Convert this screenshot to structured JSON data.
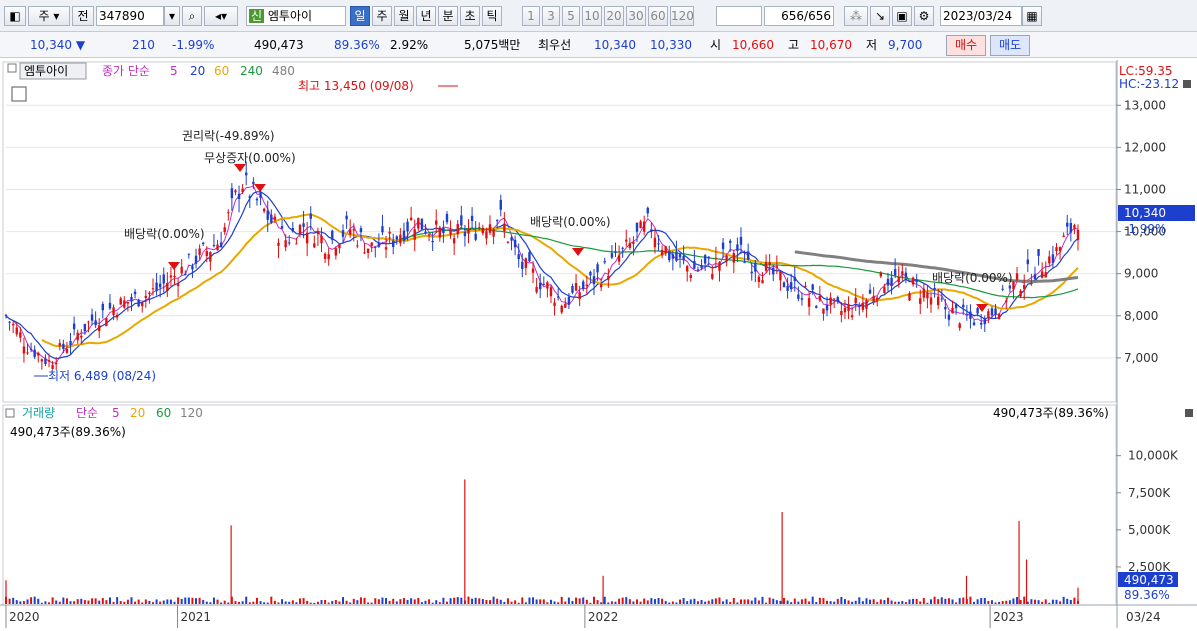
{
  "toolbar": {
    "type_label": "주",
    "jeon_label": "전",
    "code": "347890",
    "shin_label": "신",
    "name": "엠투아이",
    "periods": [
      "일",
      "주",
      "월",
      "년",
      "분",
      "초",
      "틱"
    ],
    "numbers": [
      "1",
      "3",
      "5",
      "10",
      "20",
      "30",
      "60",
      "120"
    ],
    "count": "656",
    "count_total": "/656",
    "date": "2023/03/24"
  },
  "quote": {
    "price": "10,340",
    "change": "210",
    "change_pct": "-1.99%",
    "volume": "490,473",
    "volume_pct": "89.36%",
    "turnover": "2.92%",
    "amount": "5,075백만",
    "bid_label": "최우선",
    "bid1": "10,340",
    "bid2": "10,330",
    "open_label": "시",
    "open": "10,660",
    "high_label": "고",
    "high": "10,670",
    "low_label": "저",
    "low": "9,700",
    "buy_label": "매수",
    "sell_label": "매도"
  },
  "colors": {
    "candle_up": "#e01010",
    "candle_down": "#1c3fce",
    "ma5": "#c030c0",
    "ma20": "#1c3fce",
    "ma60": "#e8a800",
    "ma240": "#1a9a3a",
    "ma480": "#808080",
    "vol_up": "#e01010",
    "vol_down": "#1c3fce"
  },
  "price_panel": {
    "legend_name": "엠투아이",
    "legend_items": [
      "종가 단순",
      "5",
      "20",
      "60",
      "240",
      "480"
    ],
    "lc": "LC:59.35",
    "hc": "HC:-23.12",
    "last_price": "10,340",
    "last_pct": "-1.99%",
    "annotations": {
      "high": "최고 13,450 (09/08)",
      "low": "최저 6,489 (08/24)",
      "rights": "권리락(-49.89%)",
      "bonus": "무상증자(0.00%)",
      "div1": "배당락(0.00%)",
      "div2": "배당락(0.00%)",
      "div3": "배당락(0.00%)"
    }
  },
  "volume_panel": {
    "legend_name": "거래량",
    "legend_items": [
      "단순",
      "5",
      "20",
      "60",
      "120"
    ],
    "label_left": "490,473주(89.36%)",
    "label_right": "490,473주(89.36%)",
    "last_volume": "490,473",
    "last_pct": "89.36%"
  },
  "chart_data": {
    "type": "candlestick",
    "y_axis": [
      "13,000",
      "12,000",
      "11,000",
      "10,000",
      "9,000",
      "8,000",
      "7,000"
    ],
    "y_values": [
      13000,
      12000,
      11000,
      10000,
      9000,
      8000,
      7000
    ],
    "ylim": [
      6000,
      13600
    ],
    "volume_axis": [
      "10,000K",
      "7,500K",
      "5,000K",
      "2,500K"
    ],
    "volume_values": [
      10000,
      7500,
      5000,
      2500
    ],
    "volume_ylim": [
      0,
      12000
    ],
    "x_axis": [
      "2020",
      "2021",
      "2022",
      "2023",
      "03/24"
    ],
    "close_path_x": [
      0,
      0.02,
      0.04,
      0.06,
      0.08,
      0.1,
      0.12,
      0.14,
      0.16,
      0.18,
      0.2,
      0.22,
      0.24,
      0.26,
      0.28,
      0.3,
      0.32,
      0.34,
      0.36,
      0.38,
      0.4,
      0.42,
      0.44,
      0.46,
      0.48,
      0.5,
      0.52,
      0.54,
      0.56,
      0.58,
      0.6,
      0.62,
      0.64,
      0.66,
      0.68,
      0.7,
      0.72,
      0.74,
      0.76,
      0.78,
      0.8,
      0.82,
      0.84,
      0.86,
      0.88,
      0.9,
      0.92,
      0.94,
      0.96,
      0.98,
      1.0
    ],
    "close": [
      8000,
      7300,
      6900,
      7400,
      7900,
      8200,
      8400,
      8600,
      9000,
      9400,
      9800,
      11200,
      10500,
      9800,
      10200,
      9700,
      10100,
      9600,
      9800,
      10300,
      10000,
      9900,
      10100,
      10400,
      9200,
      8800,
      8300,
      8700,
      9100,
      9600,
      10200,
      9400,
      9100,
      9200,
      9600,
      9200,
      8900,
      8600,
      8300,
      8100,
      8300,
      8900,
      8800,
      8500,
      8100,
      7900,
      8100,
      8700,
      9100,
      9500,
      10340
    ],
    "volume_spikes": [
      {
        "x": 0.0,
        "v": 1600
      },
      {
        "x": 0.21,
        "v": 5300
      },
      {
        "x": 0.428,
        "v": 8400
      },
      {
        "x": 0.557,
        "v": 1900
      },
      {
        "x": 0.724,
        "v": 6200
      },
      {
        "x": 0.896,
        "v": 1900
      },
      {
        "x": 0.945,
        "v": 5600
      },
      {
        "x": 0.952,
        "v": 3000
      },
      {
        "x": 1.0,
        "v": 1100
      }
    ]
  }
}
